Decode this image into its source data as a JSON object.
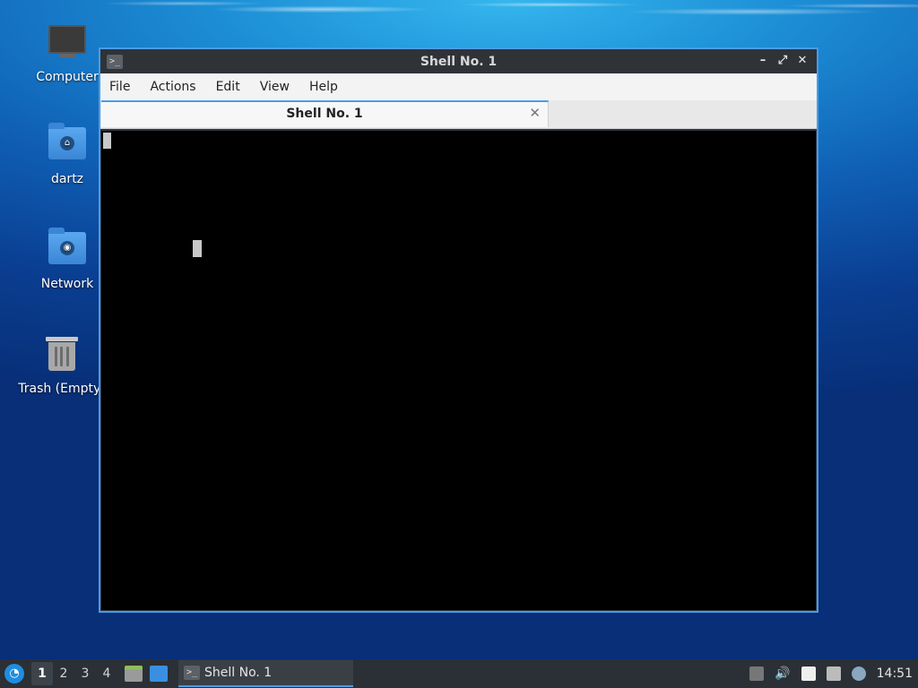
{
  "desktop": {
    "icons": [
      {
        "label": "Computer",
        "icon": "computer-icon"
      },
      {
        "label": "dartz",
        "icon": "home-folder-icon"
      },
      {
        "label": "Network",
        "icon": "network-folder-icon"
      },
      {
        "label": "Trash (Empty)",
        "icon": "trash-icon"
      }
    ]
  },
  "window": {
    "title": "Shell No. 1",
    "menu": [
      "File",
      "Actions",
      "Edit",
      "View",
      "Help"
    ],
    "tab": {
      "title": "Shell No. 1",
      "close_glyph": "✕"
    },
    "controls": {
      "minimize": "–",
      "maximize": "⤢",
      "close": "✕"
    }
  },
  "taskbar": {
    "workspaces": [
      "1",
      "2",
      "3",
      "4"
    ],
    "active_workspace": "1",
    "task_label": "Shell No. 1",
    "clock": "14:51"
  },
  "colors": {
    "accent": "#4a9ce6",
    "terminal_bg": "#000000",
    "taskbar_bg": "#2b2f36"
  }
}
